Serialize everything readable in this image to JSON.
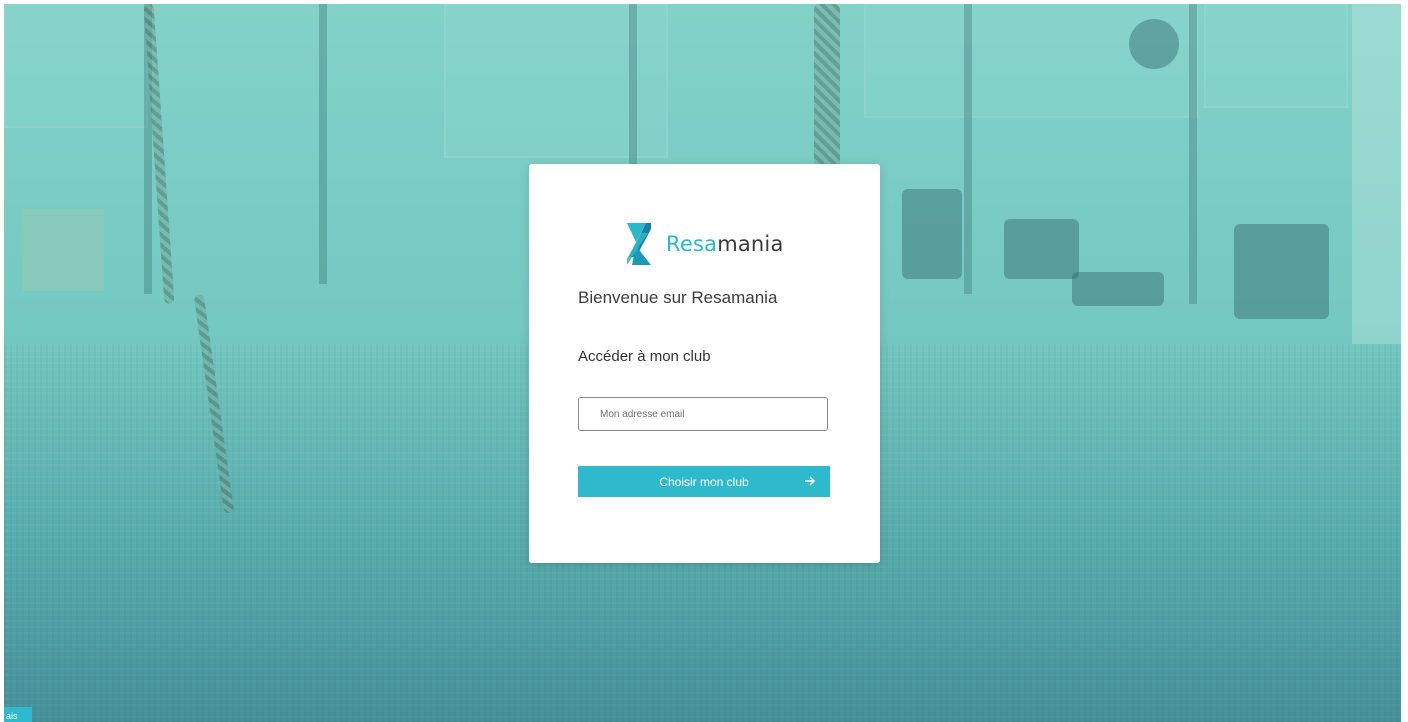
{
  "brand": {
    "name_part1": "Resa",
    "name_part2": "mania",
    "accent_color": "#2bb7c9",
    "logo_icon": "resamania-logo-icon"
  },
  "login": {
    "welcome_title": "Bienvenue sur Resamania",
    "section_title": "Accéder à mon club",
    "email_placeholder": "Mon adresse email",
    "submit_label": "Choisir mon club",
    "submit_icon": "arrow-right-icon"
  },
  "language": {
    "label": "ais"
  },
  "colors": {
    "button": "#2eb9cc",
    "background_tint": "#74cbc2"
  }
}
